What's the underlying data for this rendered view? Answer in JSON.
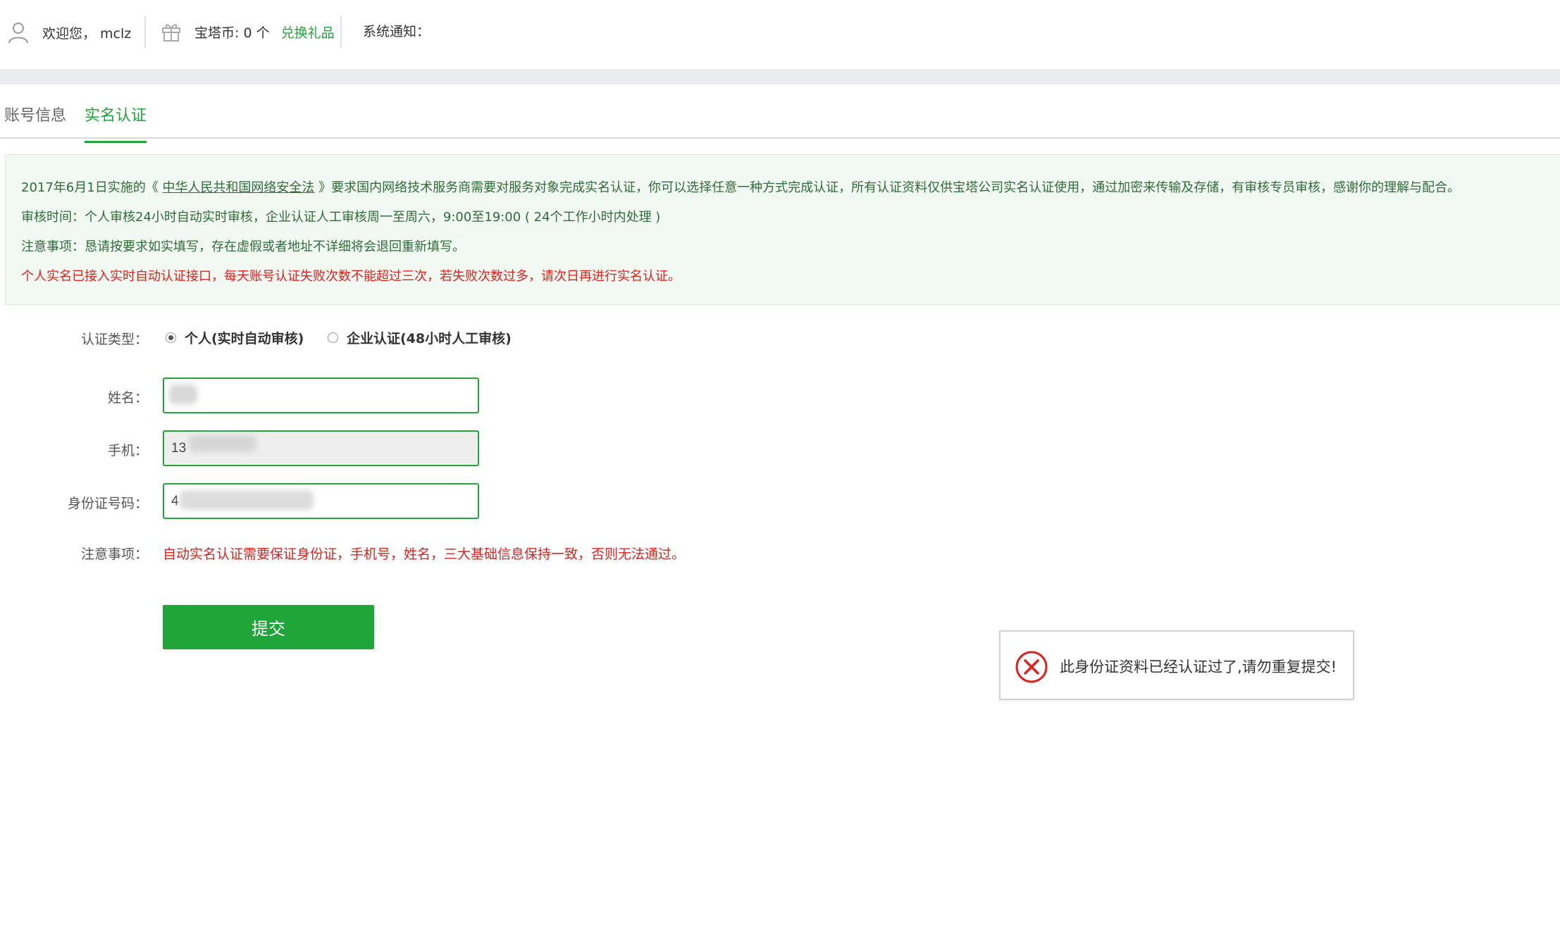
{
  "header": {
    "welcome_text": "欢迎您， mclz",
    "coin_text": "宝塔币: 0 个",
    "exchange_link": "兑换礼品",
    "notice_label": "系统通知："
  },
  "tabs": [
    {
      "label": "账号信息",
      "active": false
    },
    {
      "label": "实名认证",
      "active": true
    }
  ],
  "notice": {
    "line1_pre": "2017年6月1日实施的《 ",
    "line1_law": "中华人民共和国网络安全法",
    "line1_post": " 》要求国内网络技术服务商需要对服务对象完成实名认证，你可以选择任意一种方式完成认证，所有认证资料仅供宝塔公司实名认证使用，通过加密来传输及存储，有审核专员审核，感谢你的理解与配合。",
    "line2": "审核时间：个人审核24小时自动实时审核，企业认证人工审核周一至周六，9:00至19:00 ( 24个工作小时内处理 )",
    "line3": "注意事项：恳请按要求如实填写，存在虚假或者地址不详细将会退回重新填写。",
    "line4": "个人实名已接入实时自动认证接口，每天账号认证失败次数不能超过三次，若失败次数过多，请次日再进行实名认证。"
  },
  "form": {
    "type_label": "认证类型：",
    "type_options": [
      {
        "label": "个人(实时自动审核)",
        "checked": true
      },
      {
        "label": "企业认证(48小时人工审核)",
        "checked": false
      }
    ],
    "name_label": "姓名：",
    "name_value": "",
    "phone_label": "手机：",
    "phone_value": "13",
    "id_label": "身份证号码：",
    "id_value": "4",
    "note_label": "注意事项：",
    "note_text": "自动实名认证需要保证身份证，手机号，姓名，三大基础信息保持一致，否则无法通过。",
    "submit_label": "提交"
  },
  "toast": {
    "message": "此身份证资料已经认证过了,请勿重复提交!",
    "icon": "error-circle-x-icon",
    "color": "#e0201c"
  },
  "colors": {
    "accent": "#20a53a",
    "error": "#e0201c",
    "notice_bg": "#f1f8f2"
  }
}
